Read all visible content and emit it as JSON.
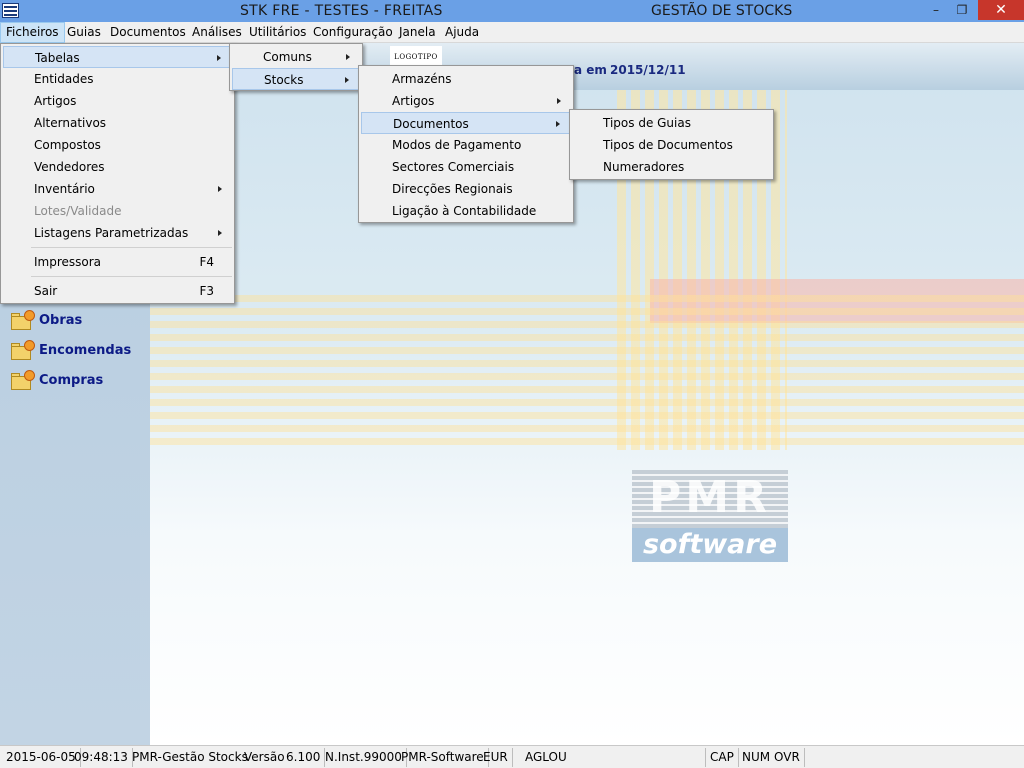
{
  "titlebar": {
    "title_left": "STK FRE - TESTES - FREITAS",
    "title_right": "GESTÃO DE STOCKS",
    "minimize": "–",
    "restore": "❐",
    "close": "✕"
  },
  "menubar": [
    "Ficheiros",
    "Guias",
    "Documentos",
    "Análises",
    "Utilitários",
    "Configuração",
    "Janela",
    "Ajuda"
  ],
  "header": {
    "logo_text": "LOGOTIPO",
    "date_label": "a em",
    "date_value": "2015/12/11"
  },
  "nav": [
    "Obras",
    "Encomendas",
    "Compras"
  ],
  "ficheiros_menu": {
    "items": [
      {
        "label": "Tabelas",
        "submenu": true
      },
      {
        "label": "Entidades"
      },
      {
        "label": "Artigos"
      },
      {
        "label": "Alternativos"
      },
      {
        "label": "Compostos"
      },
      {
        "label": "Vendedores"
      },
      {
        "label": "Inventário",
        "submenu": true
      },
      {
        "label": "Lotes/Validade",
        "disabled": true
      },
      {
        "label": "Listagens Parametrizadas",
        "submenu": true
      },
      {
        "label": "Impressora",
        "shortcut": "F4"
      },
      {
        "label": "Sair",
        "shortcut": "F3"
      }
    ]
  },
  "tabelas_menu": {
    "items": [
      {
        "label": "Comuns",
        "submenu": true
      },
      {
        "label": "Stocks",
        "submenu": true
      }
    ]
  },
  "stocks_menu": {
    "items": [
      {
        "label": "Armazéns"
      },
      {
        "label": "Artigos",
        "submenu": true
      },
      {
        "label": "Documentos",
        "submenu": true
      },
      {
        "label": "Modos de Pagamento"
      },
      {
        "label": "Sectores Comerciais"
      },
      {
        "label": "Direcções Regionais"
      },
      {
        "label": "Ligação à Contabilidade"
      }
    ]
  },
  "documentos_menu": {
    "items": [
      {
        "label": "Tipos de Guias"
      },
      {
        "label": "Tipos de Documentos"
      },
      {
        "label": "Numeradores"
      }
    ]
  },
  "logo": {
    "pmr": "PMR",
    "software": "software"
  },
  "statusbar": {
    "date": "2015-06-05",
    "time": "09:48:13",
    "app": "PMR-Gestão Stocks",
    "version_label": "Versão",
    "version": "6.100",
    "inst": "N.Inst.99000",
    "vendor": "PMR-Software",
    "currency": "EUR",
    "user": "AGLOU",
    "cap": "CAP",
    "num": "NUM",
    "ovr": "OVR"
  },
  "colors": {
    "titlebar": "#6aa0e6",
    "nav_text": "#0c1a86",
    "close_button": "#c7362b",
    "menu_highlight": "#d5e4f5"
  }
}
